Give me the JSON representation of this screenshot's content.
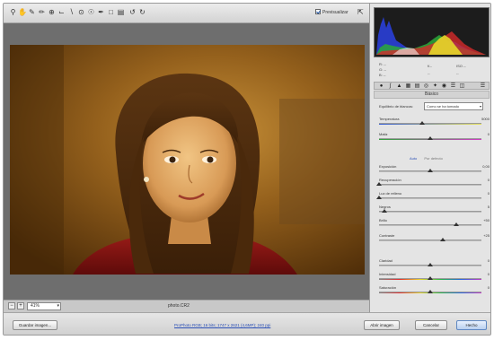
{
  "toolbar": {
    "tools": [
      "zoom-icon",
      "hand-icon",
      "white-balance-icon",
      "color-sampler-icon",
      "targeted-adjustment-icon",
      "crop-icon",
      "straighten-icon",
      "spot-removal-icon",
      "red-eye-icon",
      "adjustment-brush-icon",
      "graduated-filter-icon",
      "preferences-icon",
      "rotate-left-icon",
      "rotate-right-icon"
    ],
    "preview_label": "Previsualizar",
    "preview_checked": true
  },
  "camera_info": {
    "f_label": "f/--",
    "shutter_label": "--",
    "iso_label": "ISO --",
    "lens_label": "--",
    "r_label": "R: --",
    "g_label": "G: --",
    "b_label": "B: --"
  },
  "panel": {
    "title": "Básico",
    "white_balance_label": "Equilibrio de blancos:",
    "white_balance_value": "Como se ha tomado",
    "auto_label": "Auto",
    "default_label": "Por defecto",
    "sliders": [
      {
        "label": "Temperatura",
        "value": "5000",
        "fraction": 0.42,
        "track": "temp"
      },
      {
        "label": "Matiz",
        "value": "0",
        "fraction": 0.5,
        "track": "tint"
      },
      {
        "label": "Exposición",
        "value": "0,00",
        "fraction": 0.5,
        "track": "gray"
      },
      {
        "label": "Recuperación",
        "value": "0",
        "fraction": 0.0,
        "track": "gray"
      },
      {
        "label": "Luz de relleno",
        "value": "0",
        "fraction": 0.0,
        "track": "gray"
      },
      {
        "label": "Negros",
        "value": "5",
        "fraction": 0.05,
        "track": "gray"
      },
      {
        "label": "Brillo",
        "value": "+50",
        "fraction": 0.75,
        "track": "gray"
      },
      {
        "label": "Contraste",
        "value": "+25",
        "fraction": 0.62,
        "track": "gray"
      },
      {
        "label": "Claridad",
        "value": "0",
        "fraction": 0.5,
        "track": "gray"
      },
      {
        "label": "Intensidad",
        "value": "0",
        "fraction": 0.5,
        "track": "sat"
      },
      {
        "label": "Saturación",
        "value": "0",
        "fraction": 0.5,
        "track": "sat"
      }
    ]
  },
  "canvas": {
    "zoom_value": "41%",
    "filename": "photo.CR2"
  },
  "footer": {
    "save_label": "Guardar imagen...",
    "workflow_link": "ProPhoto RGB; 16 bits; 1747 x 2621 (4,6MP); 240 ppi",
    "open_label": "Abrir imagen",
    "cancel_label": "Cancelar",
    "done_label": "Hecho"
  },
  "colors": {
    "accent": "#5f88c2",
    "panel_bg": "#e4e4e4",
    "canvas_bg": "#6e6e6e"
  }
}
